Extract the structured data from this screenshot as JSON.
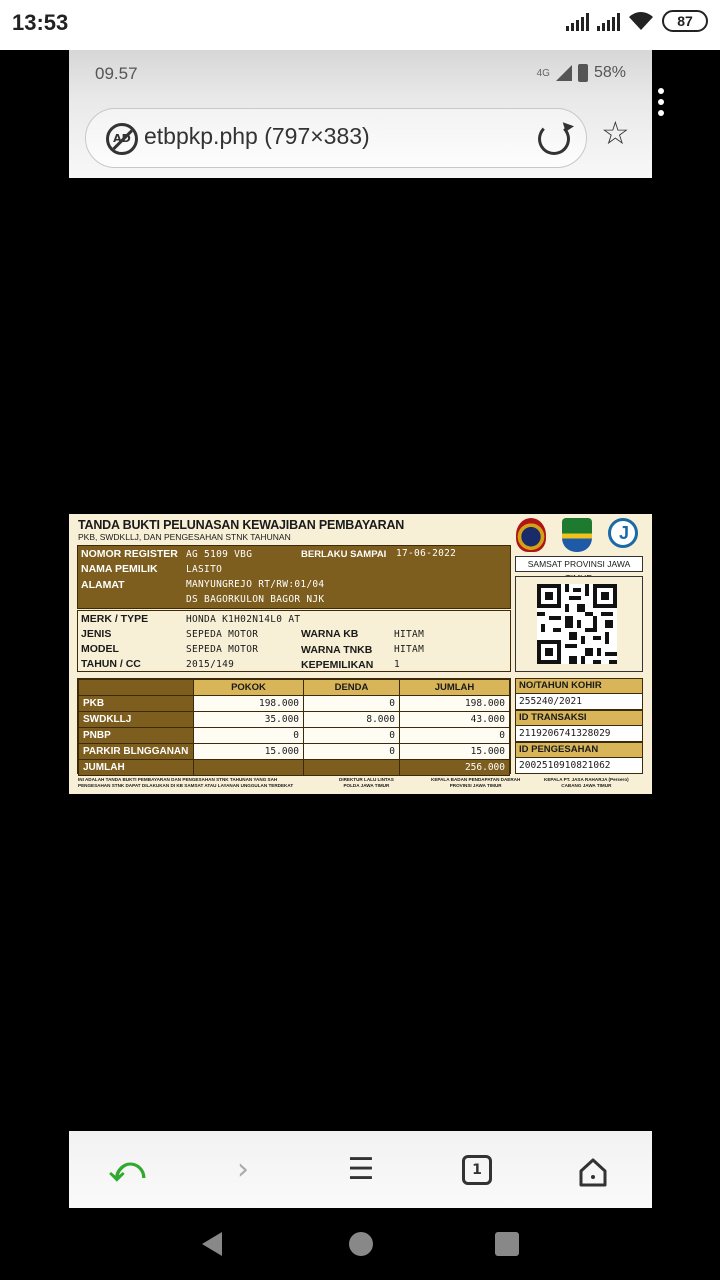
{
  "status_bar": {
    "time": "13:53",
    "battery": "87"
  },
  "inner_status": {
    "time": "09.57",
    "network": "4G",
    "battery": "58%"
  },
  "url_bar": {
    "url": "etbpkp.php (797×383)",
    "adblock_label": "AD"
  },
  "receipt": {
    "title": "TANDA BUKTI PELUNASAN KEWAJIBAN PEMBAYARAN",
    "subtitle": "PKB, SWDKLLJ, DAN PENGESAHAN STNK TAHUNAN",
    "nomor_register_label": "NOMOR REGISTER",
    "nomor_register": "AG 5109 VBG",
    "berlaku_label": "BERLAKU SAMPAI",
    "berlaku": "17-06-2022",
    "nama_label": "NAMA PEMILIK",
    "nama": "LASITO",
    "alamat_label": "ALAMAT",
    "alamat_1": "MANYUNGREJO RT/RW:01/04",
    "alamat_2": "DS BAGORKULON BAGOR NJK",
    "merk_label": "MERK / TYPE",
    "merk": "HONDA K1H02N14L0 AT",
    "jenis_label": "JENIS",
    "jenis": "SEPEDA MOTOR",
    "model_label": "MODEL",
    "model": "SEPEDA MOTOR",
    "tahun_label": "TAHUN / CC",
    "tahun": "2015/149",
    "warna_kb_label": "WARNA KB",
    "warna_kb": "HITAM",
    "warna_tnkb_label": "WARNA TNKB",
    "warna_tnkb": "HITAM",
    "kepemilikan_label": "KEPEMILIKAN",
    "kepemilikan": "1",
    "samsat": "SAMSAT PROVINSI JAWA TIMUR",
    "table": {
      "headers": [
        "POKOK",
        "DENDA",
        "JUMLAH"
      ],
      "rows": [
        {
          "label": "PKB",
          "pokok": "198.000",
          "denda": "0",
          "jumlah": "198.000"
        },
        {
          "label": "SWDKLLJ",
          "pokok": "35.000",
          "denda": "8.000",
          "jumlah": "43.000"
        },
        {
          "label": "PNBP",
          "pokok": "0",
          "denda": "0",
          "jumlah": "0"
        },
        {
          "label": "PARKIR BLNGGANAN",
          "pokok": "15.000",
          "denda": "0",
          "jumlah": "15.000"
        }
      ],
      "total_label": "JUMLAH",
      "total": "256.000"
    },
    "kohir_label": "NO/TAHUN KOHIR",
    "kohir": "255240/2021",
    "id_transaksi_label": "ID TRANSAKSI",
    "id_transaksi": "2119206741328029",
    "id_pengesahan_label": "ID PENGESAHAN",
    "id_pengesahan": "2002510910821062",
    "footnote_1a": "INI ADALAH TANDA BUKTI PEMBAYARAN DAN PENGESAHAN STNK TAHUNAN YANG SAH",
    "footnote_1b": "PENGESAHAN STNK DAPAT DILAKUKAN DI KB SAMSAT ATAU LAYANAN UNGGULAN TERDEKAT",
    "footnote_2a": "DIREKTUR LALU LINTAS",
    "footnote_2b": "POLDA JAWA TIMUR",
    "footnote_3a": "KEPALA BADAN PENDAPATAN DAERAH",
    "footnote_3b": "PROVINSI JAWA TIMUR",
    "footnote_4a": "KEPALA PT. JASA RAHARJA (Persero)",
    "footnote_4b": "CABANG JAWA TIMUR"
  },
  "browser_nav": {
    "tabs_count": "1"
  }
}
